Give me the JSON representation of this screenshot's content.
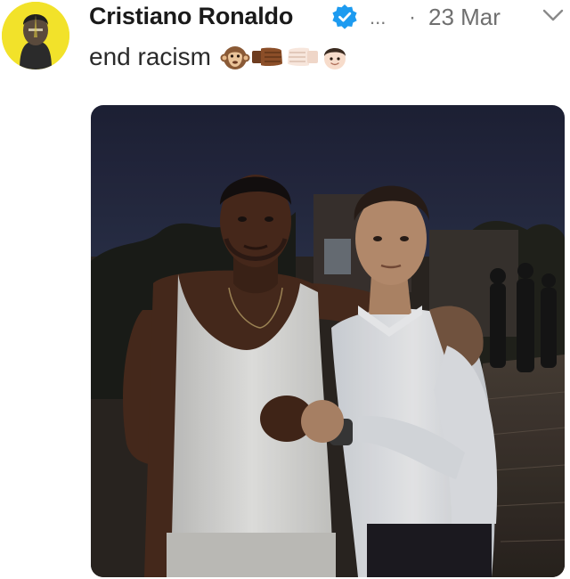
{
  "tweet": {
    "author_name": "Cristiano Ronaldo",
    "more_label": "...",
    "separator": "·",
    "date": "23 Mar",
    "text": "end racism",
    "emojis": [
      "monkey-face-emoji",
      "left-facing-fist-emoji",
      "right-facing-fist-emoji",
      "boy-emoji"
    ]
  },
  "colors": {
    "verified": "#1d9bf0",
    "meta_gray": "#6f6f6f",
    "avatar_bg": "#f2e22a"
  }
}
